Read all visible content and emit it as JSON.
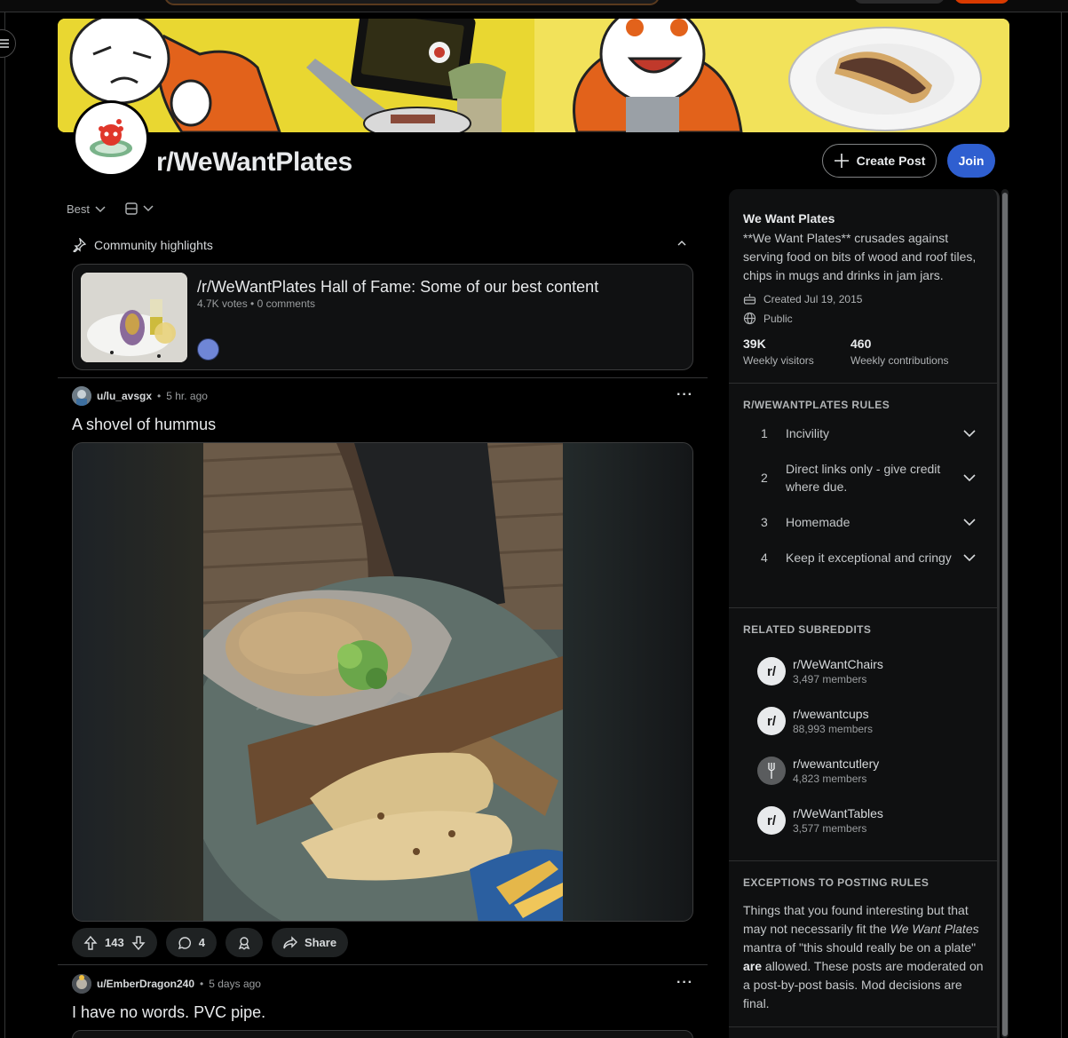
{
  "subreddit": {
    "name": "r/WeWantPlates",
    "create_post_label": "Create Post",
    "join_label": "Join"
  },
  "feed": {
    "sort_label": "Best",
    "highlights": {
      "heading": "Community highlights",
      "card": {
        "title": "/r/WeWantPlates Hall of Fame: Some of our best content",
        "votes": "4.7K votes",
        "comments": "0 comments"
      }
    },
    "posts": [
      {
        "user": "u/lu_avsgx",
        "time": "5 hr. ago",
        "title": "A shovel of hummus",
        "score": "143",
        "comments": "4",
        "share_label": "Share"
      },
      {
        "user": "u/EmberDragon240",
        "time": "5 days ago",
        "title": "I have no words. PVC pipe."
      }
    ]
  },
  "sidebar": {
    "name": "We Want Plates",
    "description": "**We Want Plates** crusades against serving food on bits of wood and roof tiles, chips in mugs and drinks in jam jars.",
    "created": "Created Jul 19, 2015",
    "visibility": "Public",
    "stats": [
      {
        "value": "39K",
        "label": "Weekly visitors"
      },
      {
        "value": "460",
        "label": "Weekly contributions"
      }
    ],
    "rules_heading": "R/WEWANTPLATES RULES",
    "rules": [
      {
        "num": "1",
        "text": "Incivility"
      },
      {
        "num": "2",
        "text": "Direct links only - give credit where due."
      },
      {
        "num": "3",
        "text": "Homemade"
      },
      {
        "num": "4",
        "text": "Keep it exceptional and cringy"
      }
    ],
    "related_heading": "RELATED SUBREDDITS",
    "related": [
      {
        "name": "r/WeWantChairs",
        "members": "3,497 members"
      },
      {
        "name": "r/wewantcups",
        "members": "88,993 members"
      },
      {
        "name": "r/wewantcutlery",
        "members": "4,823 members"
      },
      {
        "name": "r/WeWantTables",
        "members": "3,577 members"
      }
    ],
    "exceptions_heading": "EXCEPTIONS TO POSTING RULES",
    "exceptions": {
      "part1": "Things that you found interesting but that may not necessarily fit the ",
      "italic": "We Want Plates",
      "part2": " mantra of \"this should really be on a plate\" ",
      "bold": "are",
      "part3": " allowed. These posts are moderated on a post-by-post basis. Mod decisions are final."
    }
  }
}
